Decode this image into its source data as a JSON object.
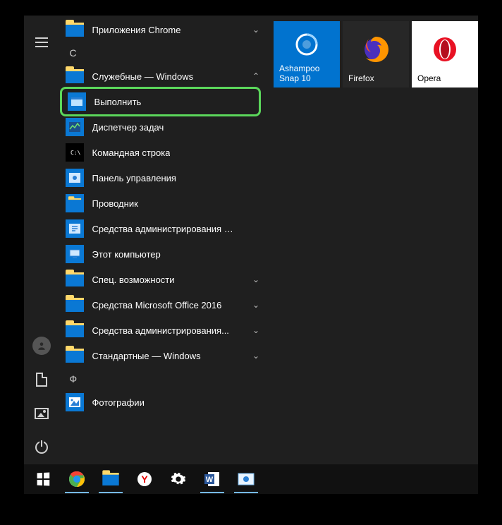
{
  "colors": {
    "accent_blue": "#0a78d4",
    "tile_blue": "#0173cf",
    "highlight_green": "#5bd75b"
  },
  "leftrail": {
    "hamburger": "menu-icon",
    "user": "user-icon",
    "documents": "document-icon",
    "pictures": "pictures-icon",
    "power": "power-icon"
  },
  "applist": {
    "top_item": {
      "label": "Приложения Chrome",
      "icon": "folder",
      "expand": "down"
    },
    "letters": {
      "c": "С",
      "f": "Ф"
    },
    "windows_tools": {
      "label": "Служебные — Windows",
      "icon": "folder",
      "expand": "up"
    },
    "subitems": [
      {
        "label": "Выполнить",
        "icon": "run",
        "highlighted": true
      },
      {
        "label": "Диспетчер задач",
        "icon": "taskmgr"
      },
      {
        "label": "Командная строка",
        "icon": "cmd"
      },
      {
        "label": "Панель управления",
        "icon": "cpanel"
      },
      {
        "label": "Проводник",
        "icon": "explorer"
      },
      {
        "label": "Средства администрирования Wi...",
        "icon": "admintools"
      },
      {
        "label": "Этот компьютер",
        "icon": "thispc"
      }
    ],
    "folders_after": [
      {
        "label": "Спец. возможности",
        "expand": "down"
      },
      {
        "label": "Средства Microsoft Office 2016",
        "expand": "down"
      },
      {
        "label": "Средства администрирования...",
        "expand": "down"
      },
      {
        "label": "Стандартные — Windows",
        "expand": "down"
      }
    ],
    "photos": {
      "label": "Фотографии",
      "icon": "photos"
    }
  },
  "tiles": [
    {
      "label": "Ashampoo Snap 10",
      "color": "blue",
      "icon": "ashampoo"
    },
    {
      "label": "Firefox",
      "color": "dark",
      "icon": "firefox"
    },
    {
      "label": "Opera",
      "color": "white",
      "icon": "opera"
    }
  ],
  "taskbar": {
    "items": [
      {
        "name": "start-button",
        "icon": "winlogo"
      },
      {
        "name": "taskbar-chrome",
        "icon": "chrome",
        "active": true
      },
      {
        "name": "taskbar-explorer",
        "icon": "explorer",
        "active": true
      },
      {
        "name": "taskbar-yandex",
        "icon": "yandex"
      },
      {
        "name": "taskbar-settings",
        "icon": "gear"
      },
      {
        "name": "taskbar-word",
        "icon": "word",
        "active": true
      },
      {
        "name": "taskbar-snap",
        "icon": "snap",
        "active": true
      }
    ]
  }
}
